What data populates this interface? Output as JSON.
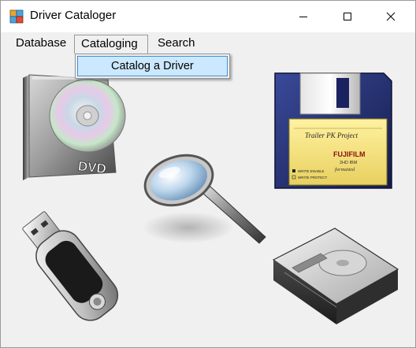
{
  "window": {
    "title": "Driver Cataloger",
    "controls": {
      "minimize": "minimize",
      "maximize": "maximize",
      "close": "close"
    }
  },
  "menubar": {
    "items": [
      {
        "label": "Database"
      },
      {
        "label": "Cataloging"
      },
      {
        "label": "Search"
      }
    ]
  },
  "dropdown": {
    "open_menu": "Cataloging",
    "items": [
      {
        "label": "Catalog a Driver",
        "highlighted": true
      }
    ]
  },
  "images": {
    "dvd_case": {
      "disc_label": "DVD"
    },
    "floppy": {
      "label_line1": "Trailer PK Project",
      "brand": "FUJIFILM",
      "model": "2HD IBM",
      "formatted": "formatted",
      "write_enable": "WRITE ENABLE",
      "write_protect": "WRITE PROTECT"
    }
  },
  "colors": {
    "titlebar": "#ffffff",
    "window_bg": "#f0f0f0",
    "menu_highlight": "#cce8ff",
    "menu_highlight_border": "#3f8fd5"
  }
}
